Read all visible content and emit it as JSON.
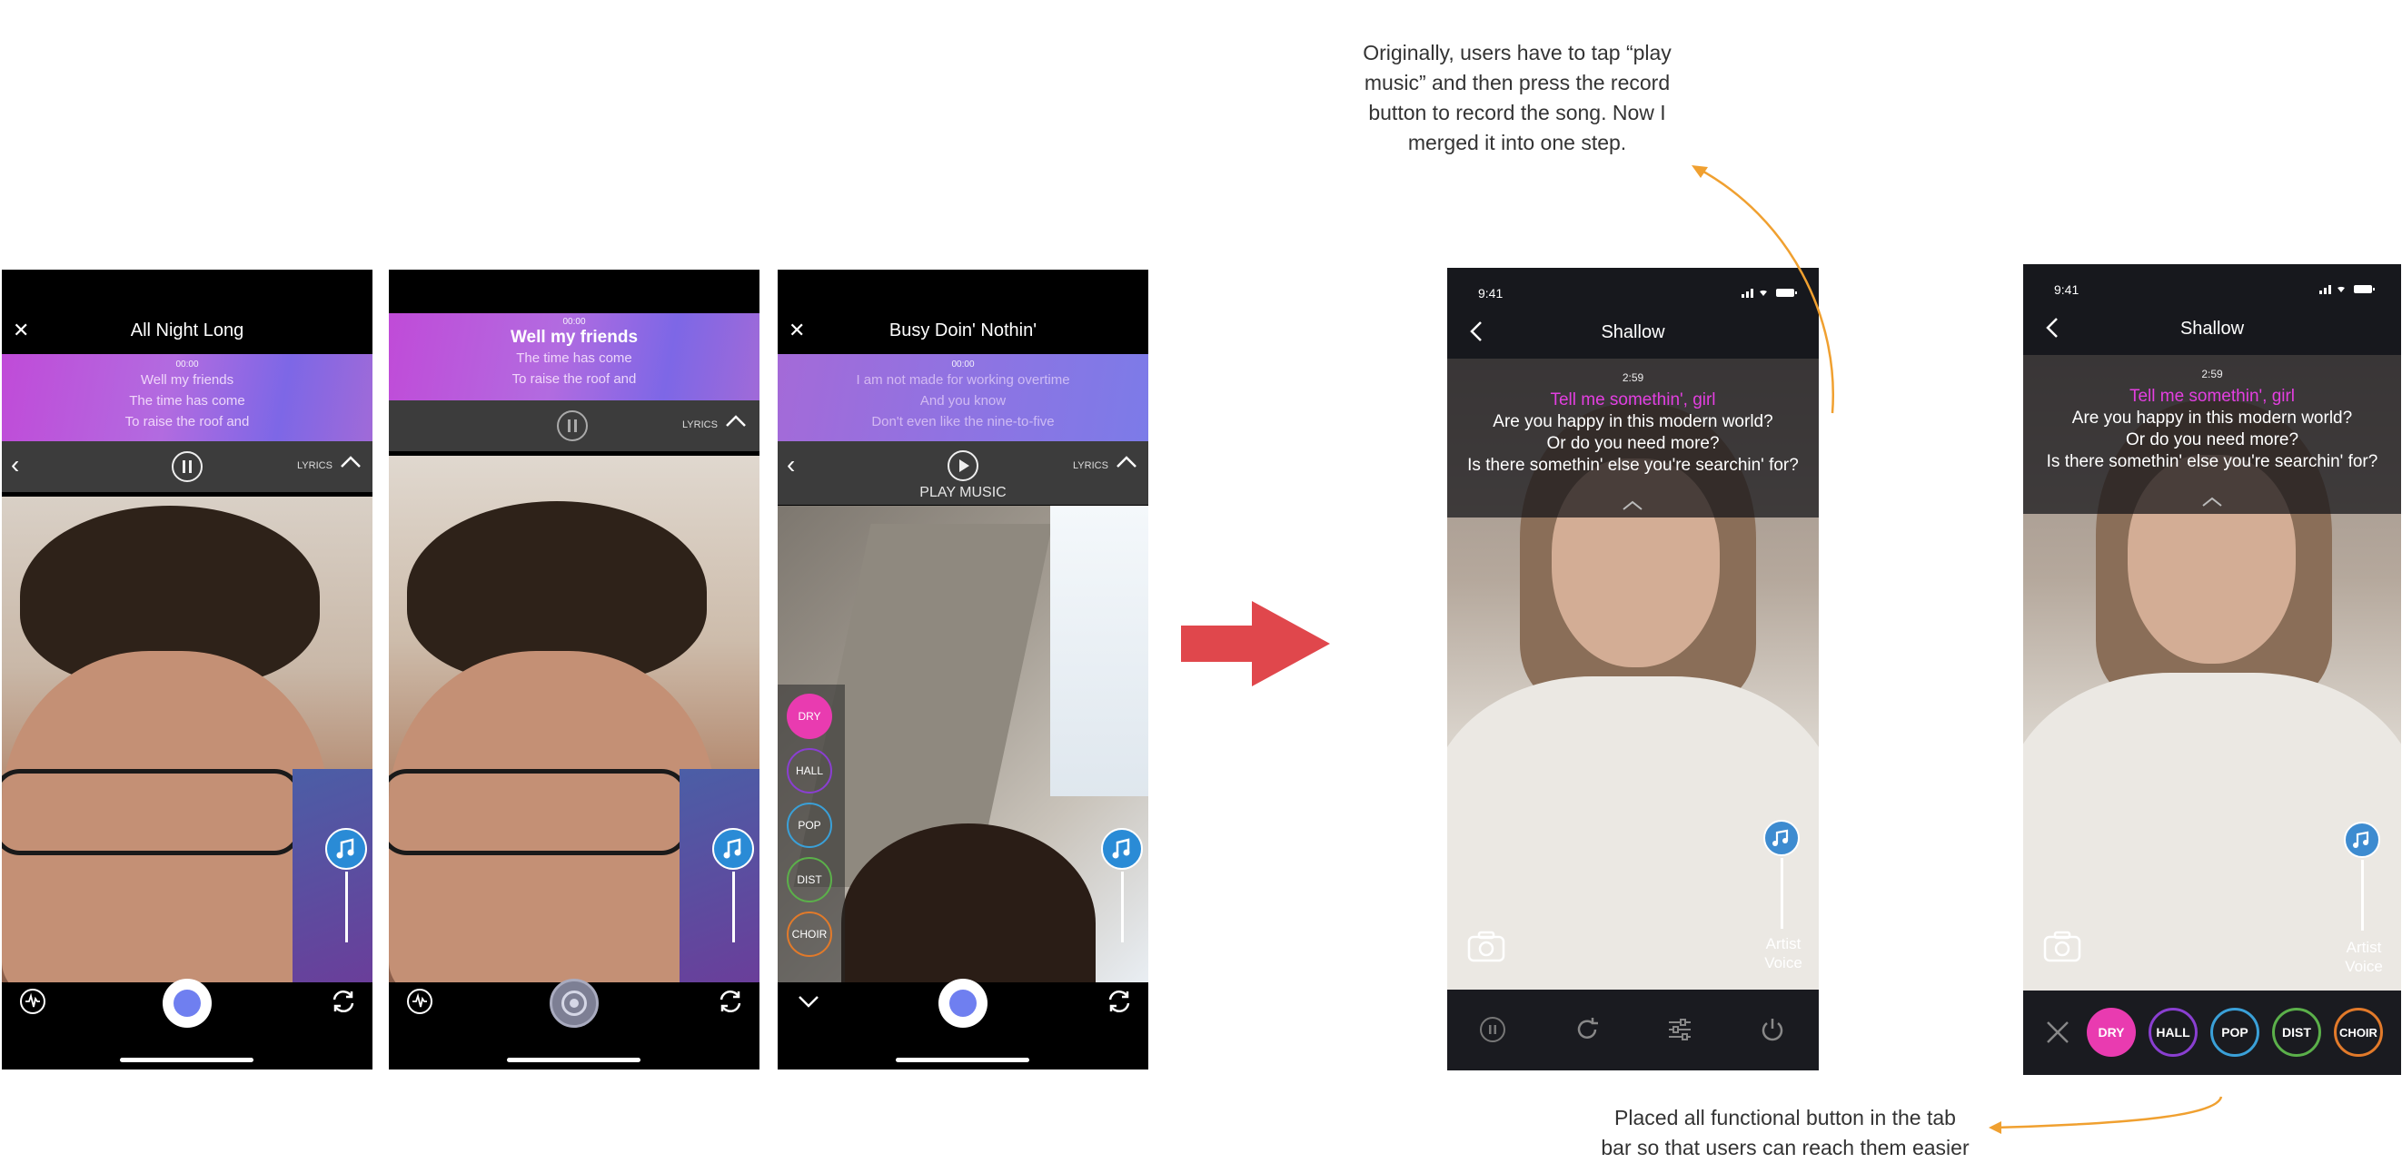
{
  "phone1": {
    "title": "All Night Long",
    "time": "00:00",
    "lyrics": [
      "Well my friends",
      "The time has come",
      "To raise the roof and"
    ],
    "lyrics_toggle": "LYRICS"
  },
  "phone2": {
    "time": "00:00",
    "lyrics": [
      "Well my friends",
      "The time has come",
      "To raise the roof and"
    ],
    "lyrics_toggle": "LYRICS"
  },
  "phone3": {
    "title": "Busy Doin' Nothin'",
    "time": "00:00",
    "lyrics": [
      "I am not made for working overtime",
      "And you know",
      "Don't even like the nine-to-five"
    ],
    "lyrics_toggle": "LYRICS",
    "play_label": "PLAY MUSIC",
    "effects": [
      {
        "label": "DRY",
        "color": "#e93bb0"
      },
      {
        "label": "HALL",
        "color": "#8a3fd1"
      },
      {
        "label": "POP",
        "color": "#3aa0d8"
      },
      {
        "label": "DIST",
        "color": "#5bb04a"
      },
      {
        "label": "CHOIR",
        "color": "#e27a2a"
      }
    ]
  },
  "mock1": {
    "status_time": "9:41",
    "title": "Shallow",
    "song_time": "2:59",
    "lyrics": [
      "Tell me somethin', girl",
      "Are you happy in this modern world?",
      "Or do you need more?",
      "Is there somethin' else you're searchin' for?"
    ],
    "voice_label": [
      "Artist",
      "Voice"
    ]
  },
  "mock2": {
    "status_time": "9:41",
    "title": "Shallow",
    "song_time": "2:59",
    "lyrics": [
      "Tell me somethin', girl",
      "Are you happy in this modern world?",
      "Or do you need more?",
      "Is there somethin' else you're searchin' for?"
    ],
    "voice_label": [
      "Artist",
      "Voice"
    ],
    "effects": [
      {
        "label": "DRY",
        "color": "#e93bb0"
      },
      {
        "label": "HALL",
        "color": "#8a3fd1"
      },
      {
        "label": "POP",
        "color": "#3aa0d8"
      },
      {
        "label": "DIST",
        "color": "#5bb04a"
      },
      {
        "label": "CHOIR",
        "color": "#e27a2a"
      }
    ]
  },
  "annotations": {
    "top": [
      "Originally, users have to tap “play",
      "music” and then press the record",
      "button to record the song. Now I",
      "merged it into one step."
    ],
    "bottom": [
      "Placed all functional button in the tab",
      "bar so that users can reach them easier"
    ]
  },
  "colors": {
    "arrow_red": "#e0474c",
    "annotation_orange": "#f0a030",
    "record_blue": "#6f7ff0",
    "lyric_highlight": "#e33fe0"
  }
}
